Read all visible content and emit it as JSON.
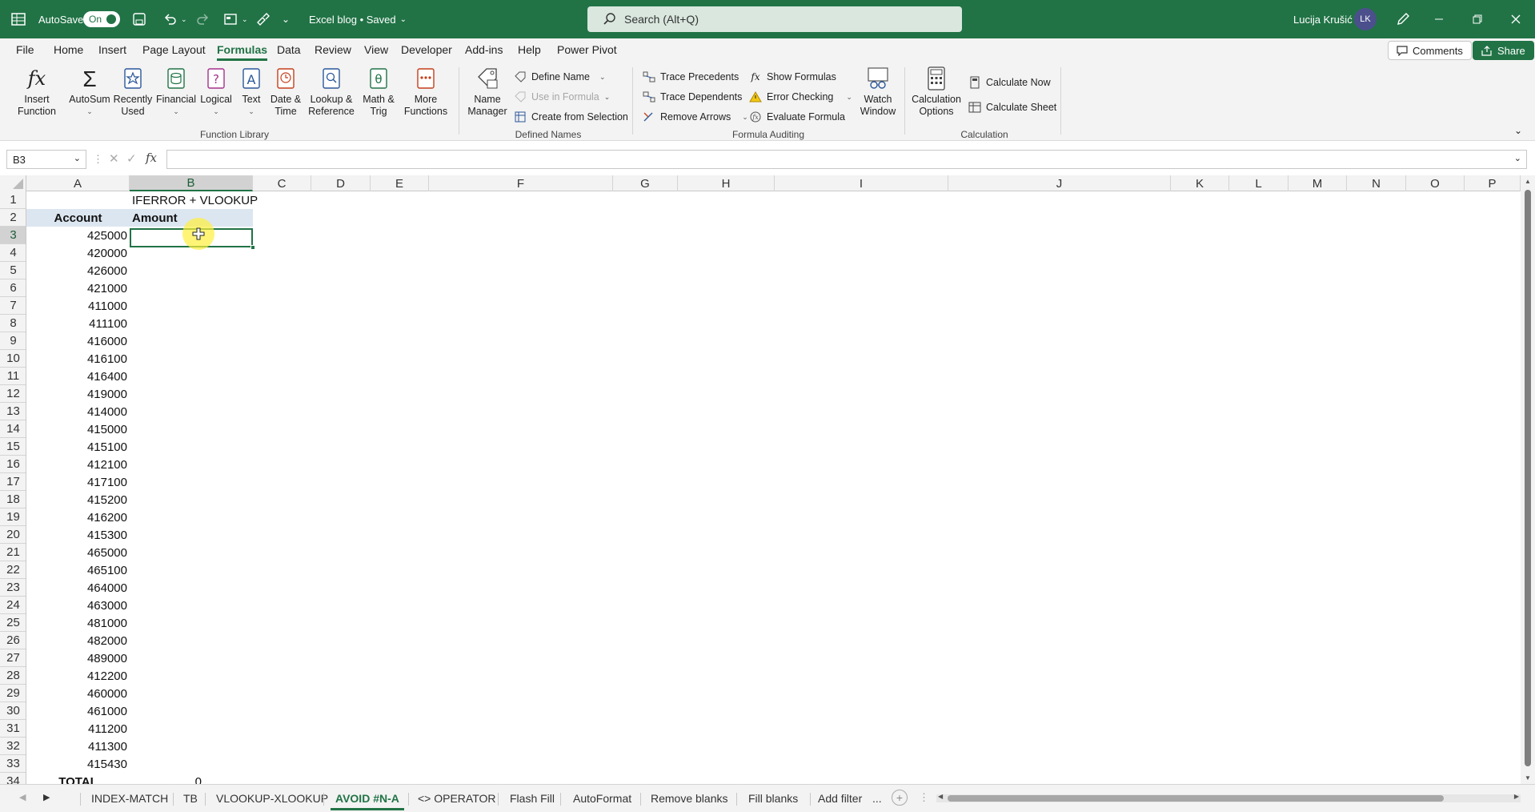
{
  "titlebar": {
    "autosave_label": "AutoSave",
    "autosave_state": "On",
    "doc_title": "Excel blog • Saved",
    "search_placeholder": "Search (Alt+Q)",
    "user_name": "Lucija Krušić",
    "user_initials": "LK"
  },
  "menu": {
    "tabs": [
      "File",
      "Home",
      "Insert",
      "Page Layout",
      "Formulas",
      "Data",
      "Review",
      "View",
      "Developer",
      "Add-ins",
      "Help",
      "Power Pivot"
    ],
    "active_tab": "Formulas",
    "comments_label": "Comments",
    "share_label": "Share"
  },
  "ribbon": {
    "function_library": {
      "label": "Function Library",
      "insert_function": [
        "Insert",
        "Function"
      ],
      "autosum": "AutoSum",
      "recently_used": [
        "Recently",
        "Used"
      ],
      "financial": "Financial",
      "logical": "Logical",
      "text": "Text",
      "date_time": [
        "Date &",
        "Time"
      ],
      "lookup_reference": [
        "Lookup &",
        "Reference"
      ],
      "math_trig": [
        "Math &",
        "Trig"
      ],
      "more_functions": [
        "More",
        "Functions"
      ]
    },
    "defined_names": {
      "label": "Defined Names",
      "name_manager": [
        "Name",
        "Manager"
      ],
      "define_name": "Define Name",
      "use_in_formula": "Use in Formula",
      "create_from_selection": "Create from Selection"
    },
    "formula_auditing": {
      "label": "Formula Auditing",
      "trace_precedents": "Trace Precedents",
      "trace_dependents": "Trace Dependents",
      "remove_arrows": "Remove Arrows",
      "show_formulas": "Show Formulas",
      "error_checking": "Error Checking",
      "evaluate_formula": "Evaluate Formula",
      "watch_window": [
        "Watch",
        "Window"
      ]
    },
    "calculation": {
      "label": "Calculation",
      "calculation_options": [
        "Calculation",
        "Options"
      ],
      "calculate_now": "Calculate Now",
      "calculate_sheet": "Calculate Sheet"
    }
  },
  "formula_bar": {
    "name_box": "B3",
    "fx_label": "fx",
    "formula": ""
  },
  "columns": [
    "A",
    "B",
    "C",
    "D",
    "E",
    "F",
    "G",
    "H",
    "I",
    "J",
    "K",
    "L",
    "M",
    "N",
    "O",
    "P"
  ],
  "selected_column": "B",
  "rows": [
    "1",
    "2",
    "3",
    "4",
    "5",
    "6",
    "7",
    "8",
    "9",
    "10",
    "11",
    "12",
    "13",
    "14",
    "15",
    "16",
    "17",
    "18",
    "19",
    "20",
    "21",
    "22",
    "23",
    "24",
    "25",
    "26",
    "27",
    "28",
    "29",
    "30",
    "31",
    "32",
    "33",
    "34"
  ],
  "selected_row": "3",
  "sheet": {
    "b1": "IFERROR + VLOOKUP",
    "a2": "Account",
    "b2": "Amount",
    "accounts": [
      "425000",
      "420000",
      "426000",
      "421000",
      "411000",
      "411100",
      "416000",
      "416100",
      "416400",
      "419000",
      "414000",
      "415000",
      "415100",
      "412100",
      "417100",
      "415200",
      "416200",
      "415300",
      "465000",
      "465100",
      "464000",
      "463000",
      "481000",
      "482000",
      "489000",
      "412200",
      "460000",
      "461000",
      "411200",
      "411300",
      "415430"
    ],
    "total_label": "TOTAL",
    "total_value": "0"
  },
  "sheet_tabs": [
    "INDEX-MATCH",
    "TB",
    "VLOOKUP-XLOOKUP",
    "AVOID #N-A",
    "<> OPERATOR",
    "Flash Fill",
    "AutoFormat",
    "Remove blanks",
    "Fill blanks",
    "Add filter",
    "..."
  ],
  "active_sheet": "AVOID #N-A"
}
